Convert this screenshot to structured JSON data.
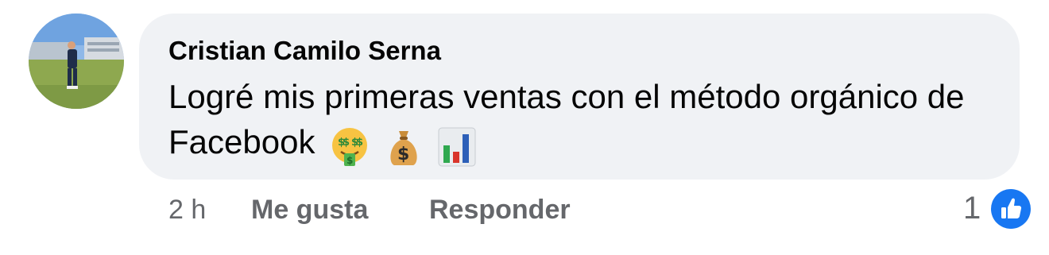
{
  "comment": {
    "author": "Cristian Camilo Serna",
    "text": "Logré mis primeras ventas con el método orgánico de Facebook",
    "emojis": [
      "money-mouth-face-icon",
      "money-bag-icon",
      "bar-chart-icon"
    ]
  },
  "actions": {
    "time": "2 h",
    "like_label": "Me gusta",
    "reply_label": "Responder"
  },
  "reactions": {
    "count": "1",
    "type": "like-reaction-icon"
  },
  "colors": {
    "bubble": "#f0f2f5",
    "text": "#050505",
    "secondary": "#65676b",
    "like_blue": "#1877f2"
  }
}
